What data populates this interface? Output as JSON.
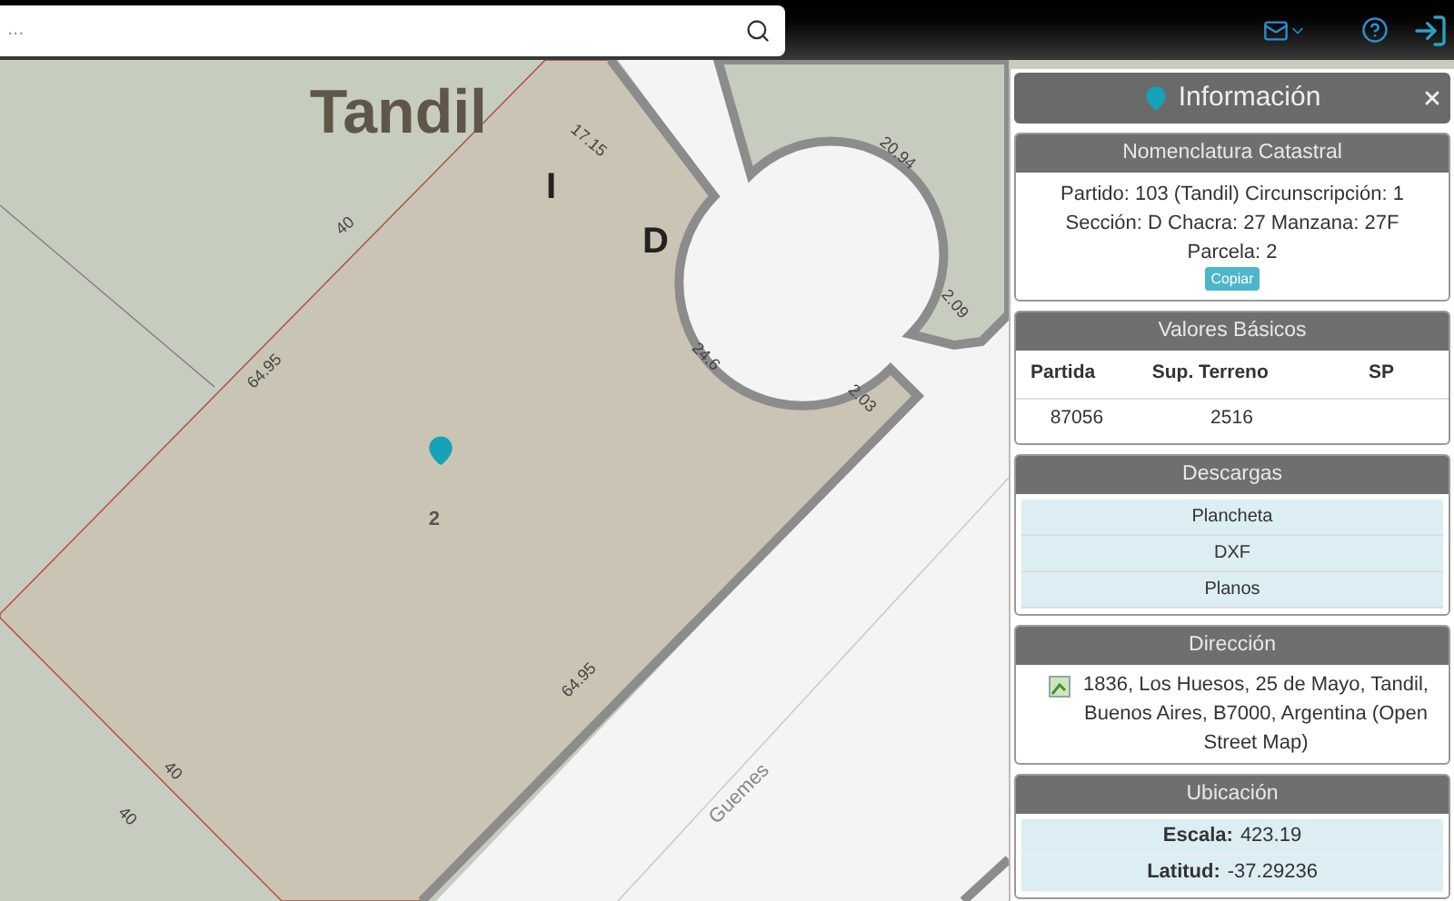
{
  "search": {
    "placeholder": "..."
  },
  "map": {
    "labels": [
      {
        "text": "Tandil",
        "kind": "town"
      },
      {
        "text": "I",
        "kind": "zone"
      },
      {
        "text": "D",
        "kind": "zone"
      },
      {
        "text": "17.15",
        "kind": "measure"
      },
      {
        "text": "20.94",
        "kind": "measure"
      },
      {
        "text": "40",
        "kind": "measure"
      },
      {
        "text": "2.09",
        "kind": "measure"
      },
      {
        "text": "24.6",
        "kind": "measure"
      },
      {
        "text": "2.03",
        "kind": "measure"
      },
      {
        "text": "64.95",
        "kind": "measure"
      },
      {
        "text": "2",
        "kind": "parcel"
      },
      {
        "text": "64.95",
        "kind": "measure"
      },
      {
        "text": "40",
        "kind": "measure"
      },
      {
        "text": "40",
        "kind": "measure"
      },
      {
        "text": "Guemes",
        "kind": "street"
      }
    ]
  },
  "info": {
    "title": "Información",
    "nomenclatura": {
      "title": "Nomenclatura Catastral",
      "text": "Partido: 103 (Tandil) Circunscripción: 1 Sección: D Chacra: 27 Manzana: 27F Parcela: 2",
      "button": "Copiar"
    },
    "valores": {
      "title": "Valores Básicos",
      "columns": [
        "Partida",
        "Sup. Terreno",
        "SP"
      ],
      "rows": [
        [
          "87056",
          "2516",
          ""
        ]
      ]
    },
    "descargas": {
      "title": "Descargas",
      "items": [
        "Plancheta",
        "DXF",
        "Planos"
      ]
    },
    "direccion": {
      "title": "Dirección",
      "text": "1836, Los Huesos, 25 de Mayo, Tandil, Buenos Aires, B7000, Argentina (Open Street Map)"
    },
    "ubicacion": {
      "title": "Ubicación",
      "rows": [
        {
          "label": "Escala:",
          "value": "423.19"
        },
        {
          "label": "Latitud:",
          "value": "-37.29236"
        }
      ]
    }
  }
}
